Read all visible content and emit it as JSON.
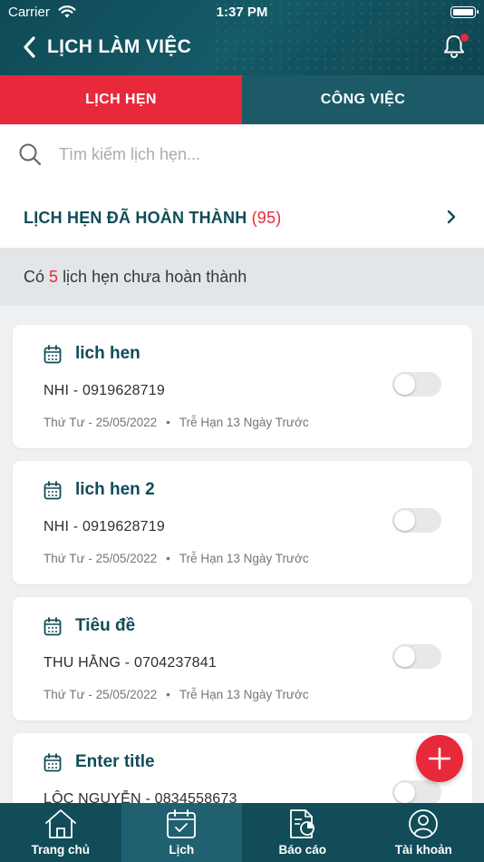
{
  "status_bar": {
    "carrier": "Carrier",
    "time": "1:37 PM"
  },
  "nav": {
    "title": "LỊCH LÀM VIỆC"
  },
  "tabs": [
    {
      "label": "LỊCH HẸN",
      "active": true
    },
    {
      "label": "CÔNG VIỆC",
      "active": false
    }
  ],
  "search": {
    "placeholder": "Tìm kiếm lịch hẹn..."
  },
  "completed": {
    "label": "LỊCH HẸN ĐÃ HOÀN THÀNH",
    "count": "(95)"
  },
  "summary": {
    "prefix": "Có",
    "count": "5",
    "suffix": "lịch hẹn chưa hoàn thành"
  },
  "appointments": [
    {
      "title": "lich hen",
      "contact": "NHI - 0919628719",
      "date": "Thứ Tư - 25/05/2022",
      "status": "Trễ Hạn 13 Ngày Trước",
      "done": false
    },
    {
      "title": "lich hen 2",
      "contact": "NHI - 0919628719",
      "date": "Thứ Tư - 25/05/2022",
      "status": "Trễ Hạn 13 Ngày Trước",
      "done": false
    },
    {
      "title": "Tiêu đề",
      "contact": "THU HẰNG - 0704237841",
      "date": "Thứ Tư - 25/05/2022",
      "status": "Trễ Hạn 13 Ngày Trước",
      "done": false
    },
    {
      "title": "Enter title",
      "contact": "LỘC NGUYỄN - 0834558673",
      "date": "",
      "status": "",
      "done": false
    }
  ],
  "meta_separator": "•",
  "bottom_nav": [
    {
      "label": "Trang chủ",
      "icon": "home-icon"
    },
    {
      "label": "Lịch",
      "icon": "calendar-icon",
      "active": true
    },
    {
      "label": "Báo cáo",
      "icon": "report-icon"
    },
    {
      "label": "Tài khoản",
      "icon": "account-icon"
    }
  ],
  "colors": {
    "brand": "#114c58",
    "accent": "#e8293b"
  }
}
